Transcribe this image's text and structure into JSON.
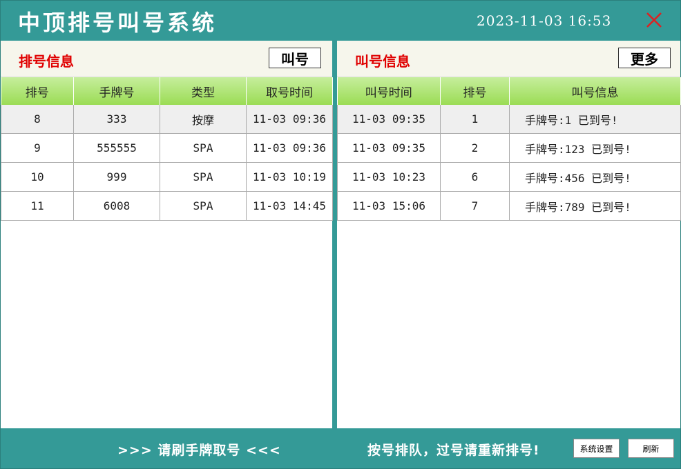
{
  "app": {
    "title": "中顶排号叫号系统",
    "datetime": "2023-11-03  16:53"
  },
  "left_panel": {
    "title": "排号信息",
    "call_button": "叫号",
    "columns": [
      "排号",
      "手牌号",
      "类型",
      "取号时间"
    ],
    "rows": [
      [
        "8",
        "333",
        "按摩",
        "11-03 09:36"
      ],
      [
        "9",
        "555555",
        "SPA",
        "11-03 09:36"
      ],
      [
        "10",
        "999",
        "SPA",
        "11-03 10:19"
      ],
      [
        "11",
        "6008",
        "SPA",
        "11-03 14:45"
      ]
    ]
  },
  "right_panel": {
    "title": "叫号信息",
    "more_button": "更多",
    "columns": [
      "叫号时间",
      "排号",
      "叫号信息"
    ],
    "rows": [
      [
        "11-03 09:35",
        "1",
        "手牌号:1 已到号!"
      ],
      [
        "11-03 09:35",
        "2",
        "手牌号:123 已到号!"
      ],
      [
        "11-03 10:23",
        "6",
        "手牌号:456 已到号!"
      ],
      [
        "11-03 15:06",
        "7",
        "手牌号:789 已到号!"
      ]
    ]
  },
  "footer": {
    "scroll_text": ">>>  请刷手牌取号  <<<",
    "notice": "按号排队，过号请重新排号!",
    "settings_button": "系统设置",
    "refresh_button": "刷新"
  },
  "colors": {
    "theme": "#349a97",
    "accent_red": "#e00000",
    "header_green": "#9bdc55"
  },
  "icons": {
    "close": "close-x-icon"
  }
}
